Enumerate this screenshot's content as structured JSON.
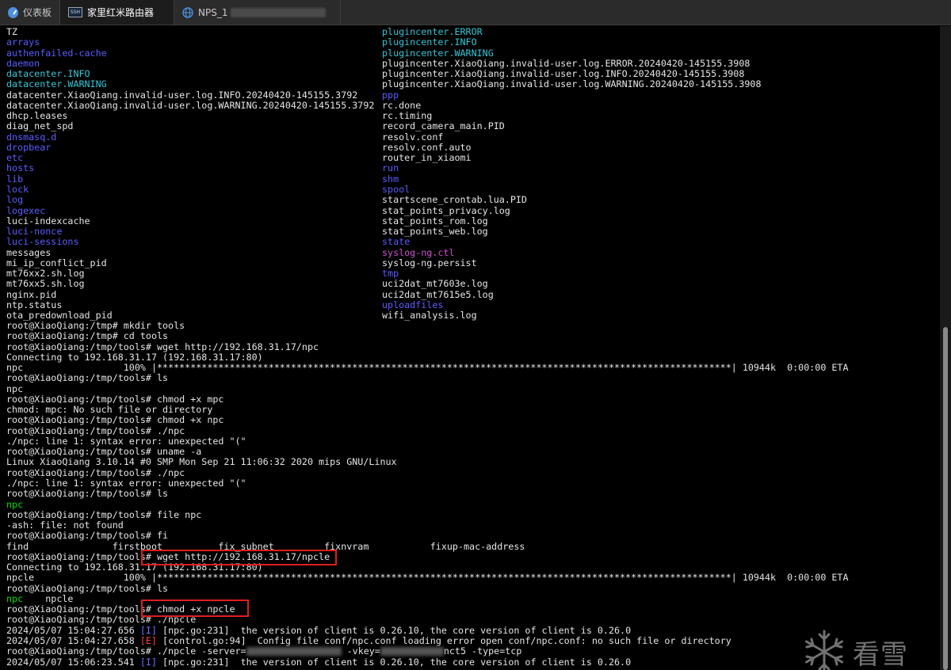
{
  "tabs": [
    {
      "label": "仪表板",
      "icon": "dashboard-icon"
    },
    {
      "label": "家里红米路由器",
      "icon": "ssh-icon",
      "icon_text": "SSH"
    },
    {
      "label": "NPS_1",
      "icon": "globe-icon"
    }
  ],
  "colors": {
    "dir": "#5c5cff",
    "link": "#30c8d8",
    "special": "#d050d0",
    "exec": "#00e000",
    "warn_tag": "#ff3c3c",
    "info_tag": "#6e6eff",
    "annotation": "#e01e1e"
  },
  "listing_left": [
    {
      "t": "TZ",
      "c": "white"
    },
    {
      "t": "arrays",
      "c": "blue"
    },
    {
      "t": "authenfailed-cache",
      "c": "blue"
    },
    {
      "t": "daemon",
      "c": "blue"
    },
    {
      "t": "datacenter.INFO",
      "c": "cyan"
    },
    {
      "t": "datacenter.WARNING",
      "c": "cyan"
    },
    {
      "t": "datacenter.XiaoQiang.invalid-user.log.INFO.20240420-145155.3792",
      "c": "white"
    },
    {
      "t": "datacenter.XiaoQiang.invalid-user.log.WARNING.20240420-145155.3792",
      "c": "white"
    },
    {
      "t": "dhcp.leases",
      "c": "white"
    },
    {
      "t": "diag_net_spd",
      "c": "white"
    },
    {
      "t": "dnsmasq.d",
      "c": "blue"
    },
    {
      "t": "dropbear",
      "c": "blue"
    },
    {
      "t": "etc",
      "c": "blue"
    },
    {
      "t": "hosts",
      "c": "blue"
    },
    {
      "t": "lib",
      "c": "blue"
    },
    {
      "t": "lock",
      "c": "blue"
    },
    {
      "t": "log",
      "c": "blue"
    },
    {
      "t": "logexec",
      "c": "blue"
    },
    {
      "t": "luci-indexcache",
      "c": "white"
    },
    {
      "t": "luci-nonce",
      "c": "blue"
    },
    {
      "t": "luci-sessions",
      "c": "blue"
    },
    {
      "t": "messages",
      "c": "white"
    },
    {
      "t": "mi_ip_conflict_pid",
      "c": "white"
    },
    {
      "t": "mt76xx2.sh.log",
      "c": "white"
    },
    {
      "t": "mt76xx5.sh.log",
      "c": "white"
    },
    {
      "t": "nginx.pid",
      "c": "white"
    },
    {
      "t": "ntp.status",
      "c": "white"
    },
    {
      "t": "ota_predownload_pid",
      "c": "white"
    }
  ],
  "listing_right": [
    {
      "t": "plugincenter.ERROR",
      "c": "cyan"
    },
    {
      "t": "plugincenter.INFO",
      "c": "cyan"
    },
    {
      "t": "plugincenter.WARNING",
      "c": "cyan"
    },
    {
      "t": "plugincenter.XiaoQiang.invalid-user.log.ERROR.20240420-145155.3908",
      "c": "white"
    },
    {
      "t": "plugincenter.XiaoQiang.invalid-user.log.INFO.20240420-145155.3908",
      "c": "white"
    },
    {
      "t": "plugincenter.XiaoQiang.invalid-user.log.WARNING.20240420-145155.3908",
      "c": "white"
    },
    {
      "t": "ppp",
      "c": "blue"
    },
    {
      "t": "rc.done",
      "c": "white"
    },
    {
      "t": "rc.timing",
      "c": "white"
    },
    {
      "t": "record_camera_main.PID",
      "c": "white"
    },
    {
      "t": "resolv.conf",
      "c": "white"
    },
    {
      "t": "resolv.conf.auto",
      "c": "white"
    },
    {
      "t": "router_in_xiaomi",
      "c": "white"
    },
    {
      "t": "run",
      "c": "blue"
    },
    {
      "t": "shm",
      "c": "blue"
    },
    {
      "t": "spool",
      "c": "blue"
    },
    {
      "t": "startscene_crontab.lua.PID",
      "c": "white"
    },
    {
      "t": "stat_points_privacy.log",
      "c": "white"
    },
    {
      "t": "stat_points_rom.log",
      "c": "white"
    },
    {
      "t": "stat_points_web.log",
      "c": "white"
    },
    {
      "t": "state",
      "c": "blue"
    },
    {
      "t": "syslog-ng.ctl",
      "c": "magenta"
    },
    {
      "t": "syslog-ng.persist",
      "c": "white"
    },
    {
      "t": "tmp",
      "c": "blue"
    },
    {
      "t": "uci2dat_mt7603e.log",
      "c": "white"
    },
    {
      "t": "uci2dat_mt7615e5.log",
      "c": "white"
    },
    {
      "t": "uploadfiles",
      "c": "blue"
    },
    {
      "t": "wifi_analysis.log",
      "c": "white"
    }
  ],
  "session": [
    [
      {
        "t": "root@XiaoQiang:/tmp# mkdir tools",
        "c": "white"
      }
    ],
    [
      {
        "t": "root@XiaoQiang:/tmp# cd tools",
        "c": "white"
      }
    ],
    [
      {
        "t": "root@XiaoQiang:/tmp/tools# wget http://192.168.31.17/npc",
        "c": "white"
      }
    ],
    [
      {
        "t": "Connecting to 192.168.31.17 (192.168.31.17:80)",
        "c": "white"
      }
    ],
    [
      {
        "t": "npc                  100% |*******************************************************************************************************| 10944k  0:00:00 ETA",
        "c": "white"
      }
    ],
    [
      {
        "t": "root@XiaoQiang:/tmp/tools# ls",
        "c": "white"
      }
    ],
    [
      {
        "t": "npc",
        "c": "white"
      }
    ],
    [
      {
        "t": "root@XiaoQiang:/tmp/tools# chmod +x mpc",
        "c": "white"
      }
    ],
    [
      {
        "t": "chmod: mpc: No such file or directory",
        "c": "white"
      }
    ],
    [
      {
        "t": "root@XiaoQiang:/tmp/tools# chmod +x npc",
        "c": "white"
      }
    ],
    [
      {
        "t": "root@XiaoQiang:/tmp/tools# ./npc",
        "c": "white"
      }
    ],
    [
      {
        "t": "./npc: line 1: syntax error: unexpected \"(\"",
        "c": "white"
      }
    ],
    [
      {
        "t": "root@XiaoQiang:/tmp/tools# uname -a",
        "c": "white"
      }
    ],
    [
      {
        "t": "Linux XiaoQiang 3.10.14 #0 SMP Mon Sep 21 11:06:32 2020 mips GNU/Linux",
        "c": "white"
      }
    ],
    [
      {
        "t": "root@XiaoQiang:/tmp/tools# ./npc",
        "c": "white"
      }
    ],
    [
      {
        "t": "./npc: line 1: syntax error: unexpected \"(\"",
        "c": "white"
      }
    ],
    [
      {
        "t": "root@XiaoQiang:/tmp/tools# ls",
        "c": "white"
      }
    ],
    [
      {
        "t": "npc",
        "c": "green"
      }
    ],
    [
      {
        "t": "root@XiaoQiang:/tmp/tools# file npc",
        "c": "white"
      }
    ],
    [
      {
        "t": "-ash: file: not found",
        "c": "white"
      }
    ],
    [
      {
        "t": "root@XiaoQiang:/tmp/tools# fi",
        "c": "white"
      }
    ],
    [
      {
        "t": "find               firstboot          fix_subnet         fixnvram           fixup-mac-address",
        "c": "white"
      }
    ],
    [
      {
        "t": "root@XiaoQiang:/tmp/tools# wget http://192.168.31.17/npcle",
        "c": "white"
      }
    ],
    [
      {
        "t": "Connecting to 192.168.31.17 (192.168.31.17:80)",
        "c": "white"
      }
    ],
    [
      {
        "t": "npcle                100% |*******************************************************************************************************| 10944k  0:00:00 ETA",
        "c": "white"
      }
    ],
    [
      {
        "t": "root@XiaoQiang:/tmp/tools# ls",
        "c": "white"
      }
    ],
    [
      {
        "t": "npc",
        "c": "green"
      },
      {
        "t": "    npcle",
        "c": "white"
      }
    ],
    [
      {
        "t": "root@XiaoQiang:/tmp/tools# chmod +x npcle",
        "c": "white"
      }
    ],
    [
      {
        "t": "root@XiaoQiang:/tmp/tools# ./npcle",
        "c": "white"
      }
    ],
    [
      {
        "t": "2024/05/07 15:04:27.656 ",
        "c": "white"
      },
      {
        "t": "[I]",
        "c": "lblue"
      },
      {
        "t": " [npc.go:231]  the version of client is 0.26.10, the core version of client is 0.26.0",
        "c": "white"
      }
    ],
    [
      {
        "t": "2024/05/07 15:04:27.658 ",
        "c": "white"
      },
      {
        "t": "[E]",
        "c": "red"
      },
      {
        "t": " [control.go:94]  Config file conf/npc.conf loading error open conf/npc.conf: no such file or directory",
        "c": "white"
      }
    ],
    [
      {
        "t": "root@XiaoQiang:/tmp/tools# ./npcle -server=",
        "c": "white"
      },
      {
        "blur": 120
      },
      {
        "t": " -vkey=",
        "c": "white"
      },
      {
        "blur": 80
      },
      {
        "t": "nct5 -type=tcp",
        "c": "white"
      }
    ],
    [
      {
        "t": "2024/05/07 15:06:23.541 ",
        "c": "white"
      },
      {
        "t": "[I]",
        "c": "lblue"
      },
      {
        "t": " [npc.go:231]  the version of client is 0.26.10, the core version of client is 0.26.0",
        "c": "white"
      }
    ]
  ],
  "watermark": {
    "text": "看雪",
    "icon": "snowflake-logo-icon"
  }
}
